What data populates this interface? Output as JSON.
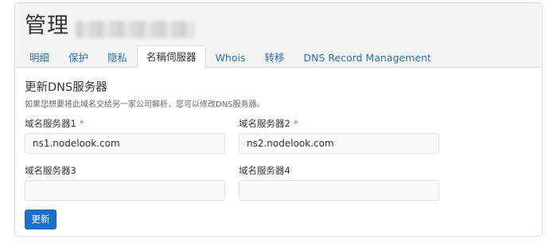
{
  "header": {
    "title": "管理"
  },
  "tabs": [
    {
      "label": "明细",
      "active": false
    },
    {
      "label": "保护",
      "active": false
    },
    {
      "label": "隐私",
      "active": false
    },
    {
      "label": "名稱伺服器",
      "active": true
    },
    {
      "label": "Whois",
      "active": false
    },
    {
      "label": "转移",
      "active": false
    },
    {
      "label": "DNS Record Management",
      "active": false
    }
  ],
  "section": {
    "title": "更新DNS服务器",
    "description": "如果您想要将此域名交给另一家公司解析，您可以修改DNS服务器。"
  },
  "fields": [
    {
      "label": "域名服务器1",
      "required": "*",
      "value": "ns1.nodelook.com"
    },
    {
      "label": "域名服务器2",
      "required": "*",
      "value": "ns2.nodelook.com"
    },
    {
      "label": "域名服务器3",
      "value": ""
    },
    {
      "label": "域名服务器4",
      "value": ""
    }
  ],
  "submit_label": "更新",
  "colors": {
    "link": "#2a6fb0",
    "primary_button": "#1e6fc9",
    "required": "#d9534f",
    "header_bg": "#f5f5f5"
  }
}
